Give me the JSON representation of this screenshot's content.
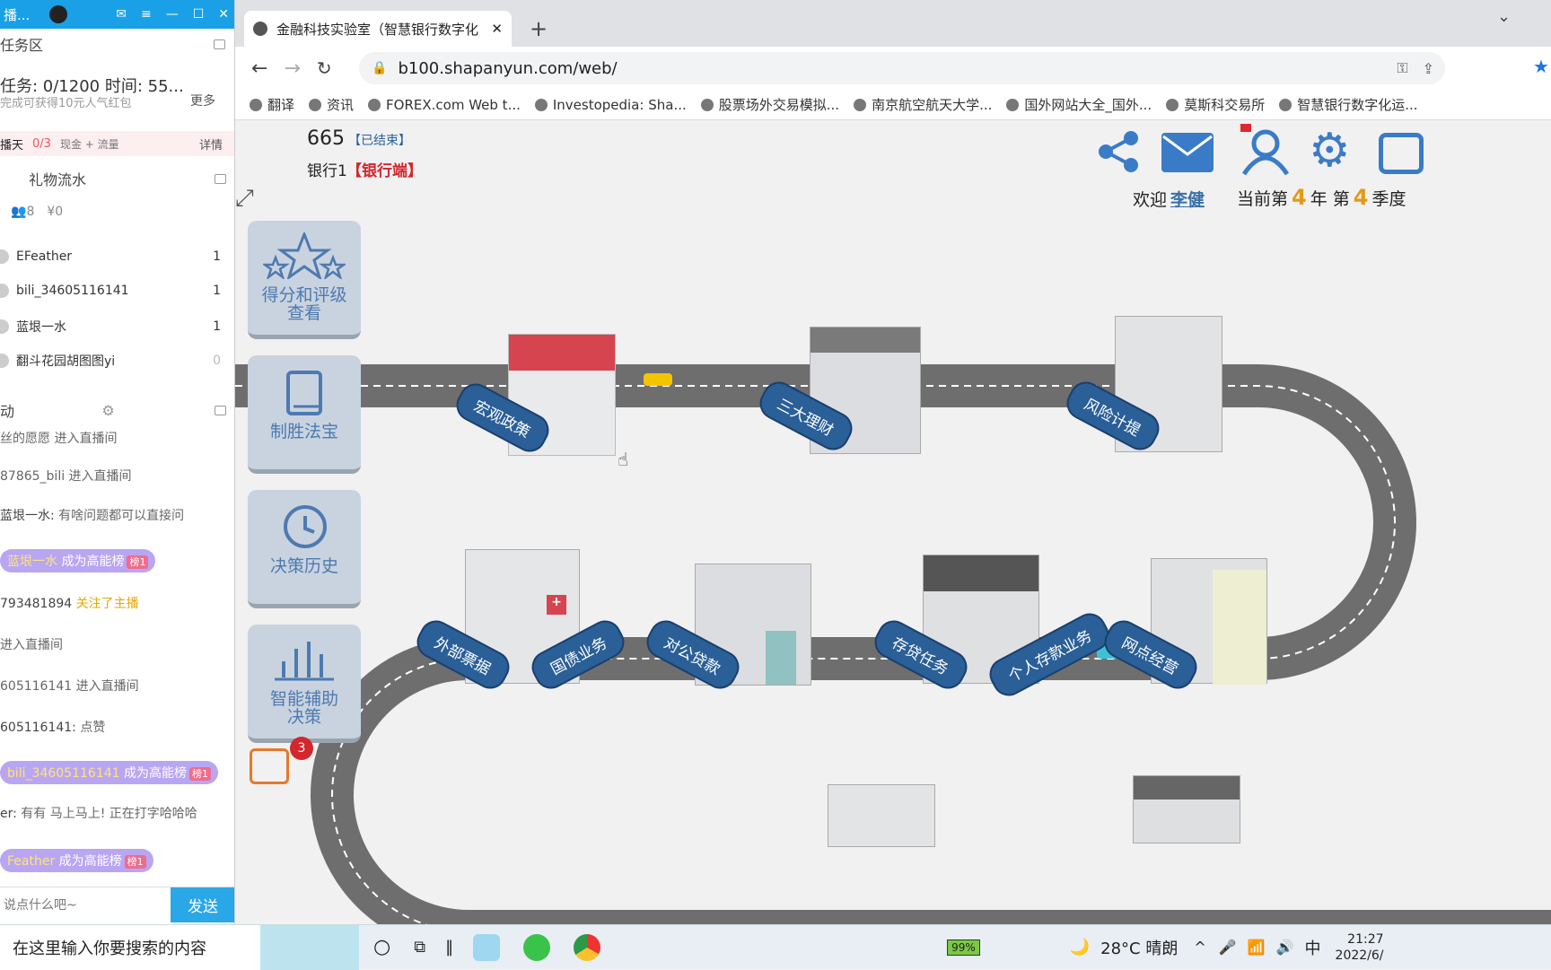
{
  "live": {
    "app_title": "播...",
    "task_section": "任务区",
    "task_line": "任务: 0/1200 时间: 55...",
    "task_reward": "完成可获得10元人气红包",
    "more": "更多",
    "subtask_label": "播天",
    "subtask_count": "0/3",
    "subtask_reward": "现金 + 流量",
    "details": "详情",
    "gift_section": "礼物流水",
    "viewers": "8",
    "money": "¥0",
    "gift_rows": [
      {
        "name": "EFeather",
        "count": "1"
      },
      {
        "name": "bili_34605116141",
        "count": "1"
      },
      {
        "name": "蓝垠一水",
        "count": "1"
      },
      {
        "name": "翻斗花园胡图图yi",
        "count": "0"
      }
    ],
    "activity_section": "动",
    "chat": [
      {
        "user": "",
        "text": "丝的愿愿 进入直播间"
      },
      {
        "user": "",
        "text": "87865_bili 进入直播间"
      },
      {
        "user": "蓝垠一水:",
        "text": "有啥问题都可以直接问"
      },
      {
        "user": "蓝垠一水",
        "text": "成为高能榜",
        "tag": "榜1"
      },
      {
        "user": "793481894",
        "text": "关注了主播"
      },
      {
        "user": "",
        "text": "进入直播间"
      },
      {
        "user": "",
        "text": "605116141 进入直播间"
      },
      {
        "user": "605116141:",
        "text": "点赞"
      },
      {
        "user": "bili_34605116141",
        "text": "成为高能榜",
        "tag": "榜1"
      },
      {
        "user": "er:",
        "text": "有有 马上马上! 正在打字哈哈哈"
      },
      {
        "user": "Feather",
        "text": "成为高能榜",
        "tag": "榜1"
      }
    ],
    "input_placeholder": "说点什么吧~",
    "send": "发送"
  },
  "browser": {
    "tab_title": "金融科技实验室（智慧银行数字化",
    "url": "b100.shapanyun.com/web/",
    "bookmarks": [
      "翻译",
      "资讯",
      "FOREX.com Web t...",
      "Investopedia: Sha...",
      "股票场外交易模拟...",
      "南京航空航天大学...",
      "国外网站大全_国外...",
      "莫斯科交易所",
      "智慧银行数字化运..."
    ]
  },
  "game": {
    "score": "665",
    "status": "【已结束】",
    "bank": "银行1",
    "role": "【银行端】",
    "welcome": "欢迎",
    "user": "李健",
    "period_prefix": "当前第",
    "year": "4",
    "year_unit": "年 第",
    "quarter": "4",
    "quarter_unit": "季度",
    "side_buttons": [
      "得分和评级查看",
      "制胜法宝",
      "决策历史",
      "智能辅助决策"
    ],
    "todo_badge": "3",
    "signs": [
      "宏观政策",
      "三大理财",
      "风险计提",
      "外部票据",
      "国债业务",
      "对公贷款",
      "存贷任务",
      "个人存款业务",
      "网点经营"
    ]
  },
  "taskbar": {
    "search": "在这里输入你要搜索的内容",
    "battery": "99%",
    "weather": "28°C 晴朗",
    "ime": "中",
    "time": "21:27",
    "date": "2022/6/"
  }
}
